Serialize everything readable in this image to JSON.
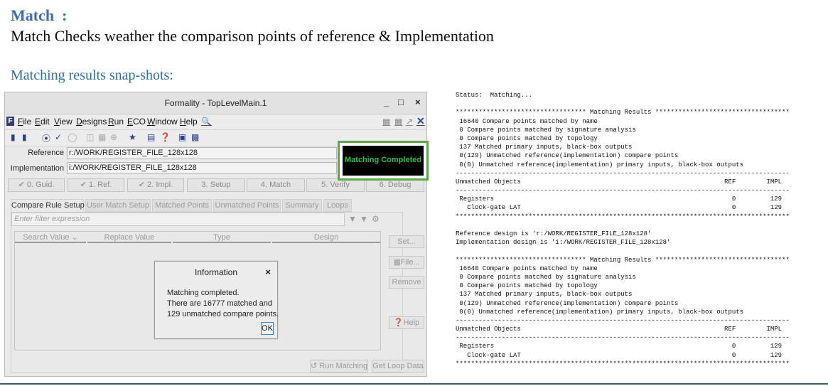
{
  "slide": {
    "title": "Match  :",
    "subtitle": "Match Checks weather the comparison points of reference & Implementation",
    "snapshots_heading": "Matching results snap-shots:"
  },
  "window": {
    "title": "Formality - TopLevelMain.1",
    "controls": [
      "_",
      "□",
      "×"
    ],
    "menu": [
      "File",
      "Edit",
      "View",
      "Designs",
      "Run",
      "ECO",
      "Window",
      "Help"
    ],
    "reference_label": "Reference",
    "reference_value": "r:/WORK/REGISTER_FILE_128x128",
    "implementation_label": "Implementation",
    "implementation_value": "i:/WORK/REGISTER_FILE_128x128",
    "steps": [
      "0. Guid.",
      "1. Ref.",
      "2. Impl.",
      "3. Setup",
      "4. Match",
      "5. Verify",
      "6. Debug"
    ],
    "tabs": [
      "Compare Rule Setup",
      "User Match Setup",
      "Matched Points",
      "Unmatched Points",
      "Summary",
      "Loops"
    ],
    "filter_placeholder": "Enter filter expression",
    "columns": [
      "Search Value",
      "Replace Value",
      "Type",
      "Design"
    ],
    "side_buttons": [
      "Set...",
      "File...",
      "Remove",
      "Help"
    ],
    "bottom_buttons": [
      "Run Matching",
      "Get Loop Data"
    ],
    "status_banner": "Matching Completed"
  },
  "dialog": {
    "title": "Information",
    "close": "×",
    "lines": [
      "Matching completed.",
      "There are 16777 matched and",
      "129 unmatched compare points."
    ],
    "ok_label": "OK"
  },
  "log": {
    "lines": [
      "Status:  Matching...",
      "",
      "********************************** Matching Results ***********************************",
      " 16640 Compare points matched by name",
      " 0 Compare points matched by signature analysis",
      " 0 Compare points matched by topology",
      " 137 Matched primary inputs, black-box outputs",
      " 0(129) Unmatched reference(implementation) compare points",
      " 0(0) Unmatched reference(implementation) primary inputs, black-box outputs",
      "---------------------------------------------------------------------------------------",
      "Unmatched Objects                                                     REF        IMPL",
      "---------------------------------------------------------------------------------------",
      " Registers                                                              0         129",
      "   Clock-gate LAT                                                       0         129",
      "***************************************************************************************",
      "",
      "Reference design is 'r:/WORK/REGISTER_FILE_128x128'",
      "Implementation design is 'i:/WORK/REGISTER_FILE_128x128'",
      "",
      "********************************** Matching Results ***********************************",
      " 16640 Compare points matched by name",
      " 0 Compare points matched by signature analysis",
      " 0 Compare points matched by topology",
      " 137 Matched primary inputs, black-box outputs",
      " 0(129) Unmatched reference(implementation) compare points",
      " 0(0) Unmatched reference(implementation) primary inputs, black-box outputs",
      "---------------------------------------------------------------------------------------",
      "Unmatched Objects                                                     REF        IMPL",
      "---------------------------------------------------------------------------------------",
      " Registers                                                              0         129",
      "   Clock-gate LAT                                                       0         129",
      "***************************************************************************************"
    ]
  }
}
